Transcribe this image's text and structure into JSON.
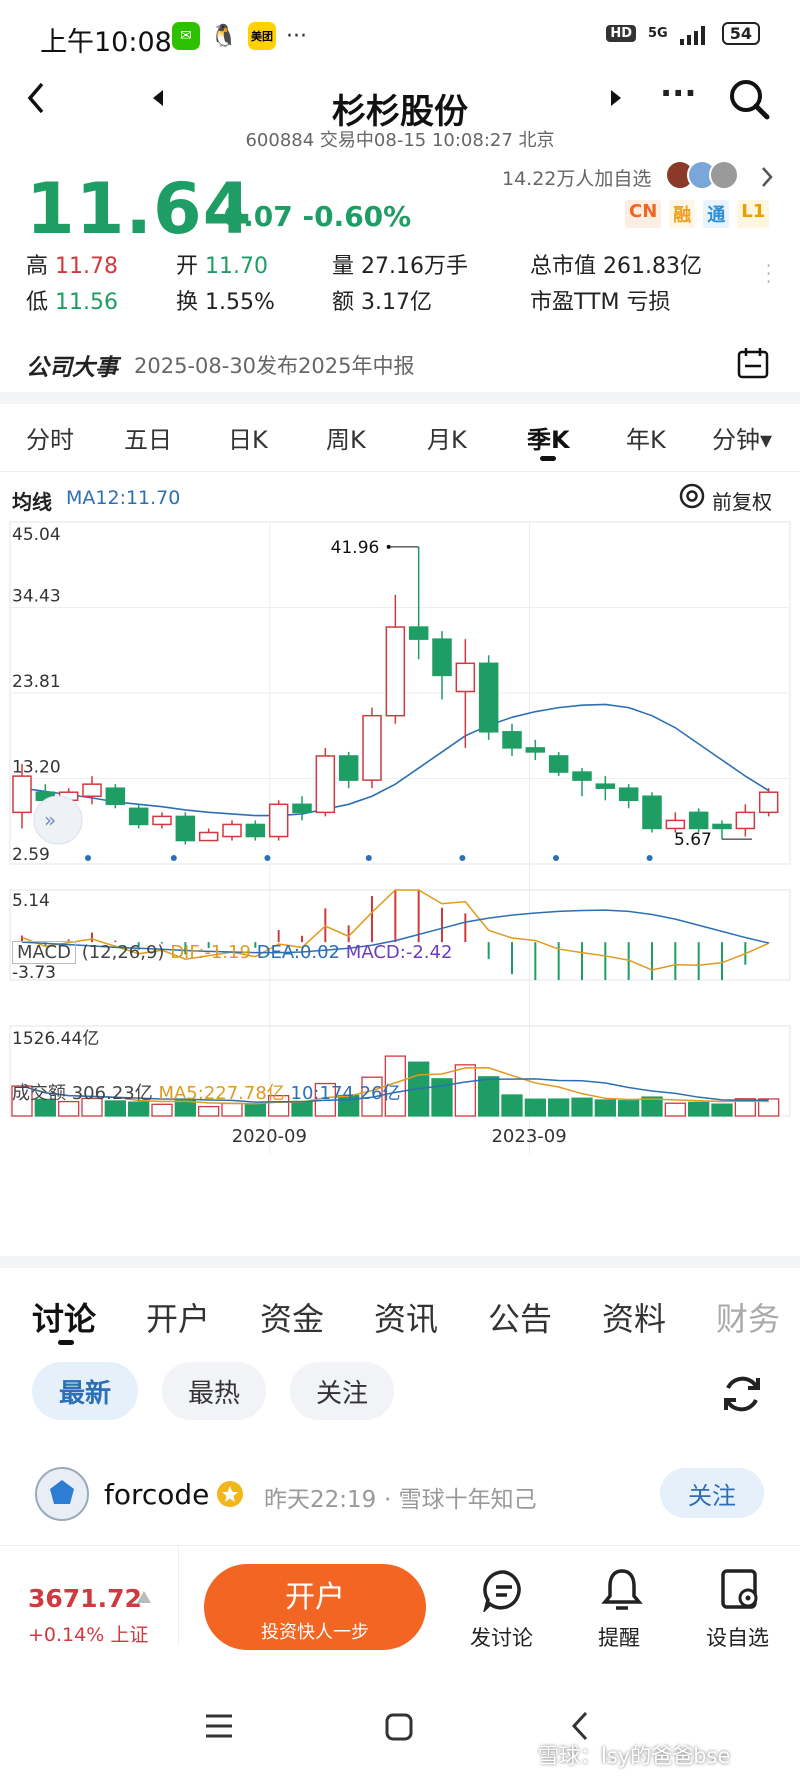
{
  "status_bar": {
    "time": "上午10:08",
    "app_meituan": "美团",
    "more": "···",
    "hd": "HD",
    "network": "5G",
    "battery": "54"
  },
  "header": {
    "title": "杉杉股份",
    "subtitle": "600884 交易中08-15 10:08:27 北京",
    "more": "···"
  },
  "quote": {
    "price": "11.64",
    "change": "-0.07 -0.60%",
    "followers": "14.22万人加自选",
    "tags": [
      "CN",
      "融",
      "通",
      "L1"
    ],
    "high_label": "高",
    "high": "11.78",
    "open_label": "开",
    "open": "11.70",
    "volume_label": "量",
    "volume": "27.16万手",
    "mktcap_label": "总市值",
    "mktcap": "261.83亿",
    "low_label": "低",
    "low": "11.56",
    "turnover_label": "换",
    "turnover": "1.55%",
    "amount_label": "额",
    "amount": "3.17亿",
    "pe_label": "市盈TTM",
    "pe": "亏损"
  },
  "events": {
    "label": "公司大事",
    "text": "2025-08-30发布2025年中报"
  },
  "period_tabs": [
    "分时",
    "五日",
    "日K",
    "周K",
    "月K",
    "季K",
    "年K",
    "分钟▾"
  ],
  "active_tab": "季K",
  "chart_header": {
    "ma_label": "均线",
    "ma_value": "MA12:11.70",
    "adjust": "前复权"
  },
  "colors": {
    "up": "#d0393e",
    "down": "#1e9e64",
    "ma": "#2d6fb5",
    "dif": "#e09a1d",
    "accent": "#f26522"
  },
  "chart_data": [
    {
      "type": "candlestick",
      "y_ticks": [
        "45.04",
        "34.43",
        "23.81",
        "13.20",
        "2.59"
      ],
      "ylim": [
        2.59,
        45.04
      ],
      "annotations": {
        "high": "41.96",
        "low": "5.67"
      },
      "candles": [
        {
          "o": 9,
          "c": 13.5,
          "h": 15,
          "l": 7
        },
        {
          "o": 11.5,
          "c": 10.5,
          "h": 12.5,
          "l": 9
        },
        {
          "o": 10.5,
          "c": 11.5,
          "h": 12,
          "l": 9.5
        },
        {
          "o": 11,
          "c": 12.5,
          "h": 13.5,
          "l": 10
        },
        {
          "o": 12,
          "c": 10,
          "h": 12.5,
          "l": 9.5
        },
        {
          "o": 9.5,
          "c": 7.5,
          "h": 10,
          "l": 7
        },
        {
          "o": 7.5,
          "c": 8.5,
          "h": 9,
          "l": 7
        },
        {
          "o": 8.5,
          "c": 5.5,
          "h": 9,
          "l": 5
        },
        {
          "o": 5.5,
          "c": 6.5,
          "h": 7,
          "l": 5.5
        },
        {
          "o": 6,
          "c": 7.5,
          "h": 8,
          "l": 5.5
        },
        {
          "o": 7.5,
          "c": 6,
          "h": 8,
          "l": 5.5
        },
        {
          "o": 6,
          "c": 10,
          "h": 10.5,
          "l": 5.5
        },
        {
          "o": 10,
          "c": 9,
          "h": 11,
          "l": 8
        },
        {
          "o": 9,
          "c": 16,
          "h": 17,
          "l": 8.5
        },
        {
          "o": 16,
          "c": 13,
          "h": 16.5,
          "l": 12
        },
        {
          "o": 13,
          "c": 21,
          "h": 22,
          "l": 12
        },
        {
          "o": 21,
          "c": 32,
          "h": 36,
          "l": 20
        },
        {
          "o": 32,
          "c": 30.5,
          "h": 41.96,
          "l": 28
        },
        {
          "o": 30.5,
          "c": 26,
          "h": 31.5,
          "l": 23
        },
        {
          "o": 24,
          "c": 27.5,
          "h": 30.5,
          "l": 17
        },
        {
          "o": 27.5,
          "c": 19,
          "h": 28.5,
          "l": 18
        },
        {
          "o": 19,
          "c": 17,
          "h": 20,
          "l": 16
        },
        {
          "o": 17,
          "c": 16.5,
          "h": 18,
          "l": 15.5
        },
        {
          "o": 16,
          "c": 14,
          "h": 16.5,
          "l": 13.5
        },
        {
          "o": 14,
          "c": 13,
          "h": 14.5,
          "l": 11
        },
        {
          "o": 12.5,
          "c": 12,
          "h": 13.5,
          "l": 10.5
        },
        {
          "o": 12,
          "c": 10.5,
          "h": 12.5,
          "l": 9.5
        },
        {
          "o": 11,
          "c": 7,
          "h": 11.5,
          "l": 6.5
        },
        {
          "o": 7,
          "c": 8,
          "h": 9,
          "l": 6.5
        },
        {
          "o": 9,
          "c": 7,
          "h": 9.5,
          "l": 6.5
        },
        {
          "o": 7.5,
          "c": 7,
          "h": 8,
          "l": 5.67
        },
        {
          "o": 7,
          "c": 9,
          "h": 10,
          "l": 6
        },
        {
          "o": 9,
          "c": 11.5,
          "h": 12,
          "l": 8.5
        }
      ],
      "ma12": [
        12,
        11.6,
        11.2,
        10.8,
        10.3,
        10,
        9.7,
        9.3,
        9,
        8.8,
        8.6,
        8.6,
        8.8,
        9.4,
        10,
        11,
        12.5,
        14.5,
        16.5,
        18.5,
        19.8,
        20.8,
        21.5,
        22,
        22.3,
        22.4,
        22,
        21,
        19.5,
        17.5,
        15.5,
        13.5,
        11.7
      ]
    },
    {
      "type": "macd",
      "label": "MACD",
      "params": "(12,26,9)",
      "dif_label": "DIF:-1.19",
      "dea_label": "DEA:0.02",
      "macd_label": "MACD:-2.42",
      "y_ticks": [
        "5.14",
        "-3.73"
      ],
      "ylim": [
        -3.73,
        5.14
      ]
    },
    {
      "type": "bar",
      "label": "成交额",
      "value": "306.23亿",
      "ma5_label": "MA5:227.78亿",
      "ma10_label": "10:174.26亿",
      "y_max_label": "1526.44亿",
      "x_ticks": [
        "2020-09",
        "2023-09"
      ]
    }
  ],
  "discussion": {
    "tabs": [
      "讨论",
      "开户",
      "资金",
      "资讯",
      "公告",
      "资料",
      "财务"
    ],
    "filters": [
      "最新",
      "最热",
      "关注"
    ],
    "post": {
      "user": "forcode",
      "time": "昨天22:19",
      "source": "· 雪球十年知己",
      "follow": "关注"
    }
  },
  "bottom_bar": {
    "index_value": "3671.72",
    "index_change": "+0.14% 上证",
    "open_account": "开户",
    "open_account_sub": "投资快人一步",
    "discuss": "发讨论",
    "alert": "提醒",
    "watchlist": "设自选"
  },
  "watermark": "雪球：lsy的爸爸bse"
}
